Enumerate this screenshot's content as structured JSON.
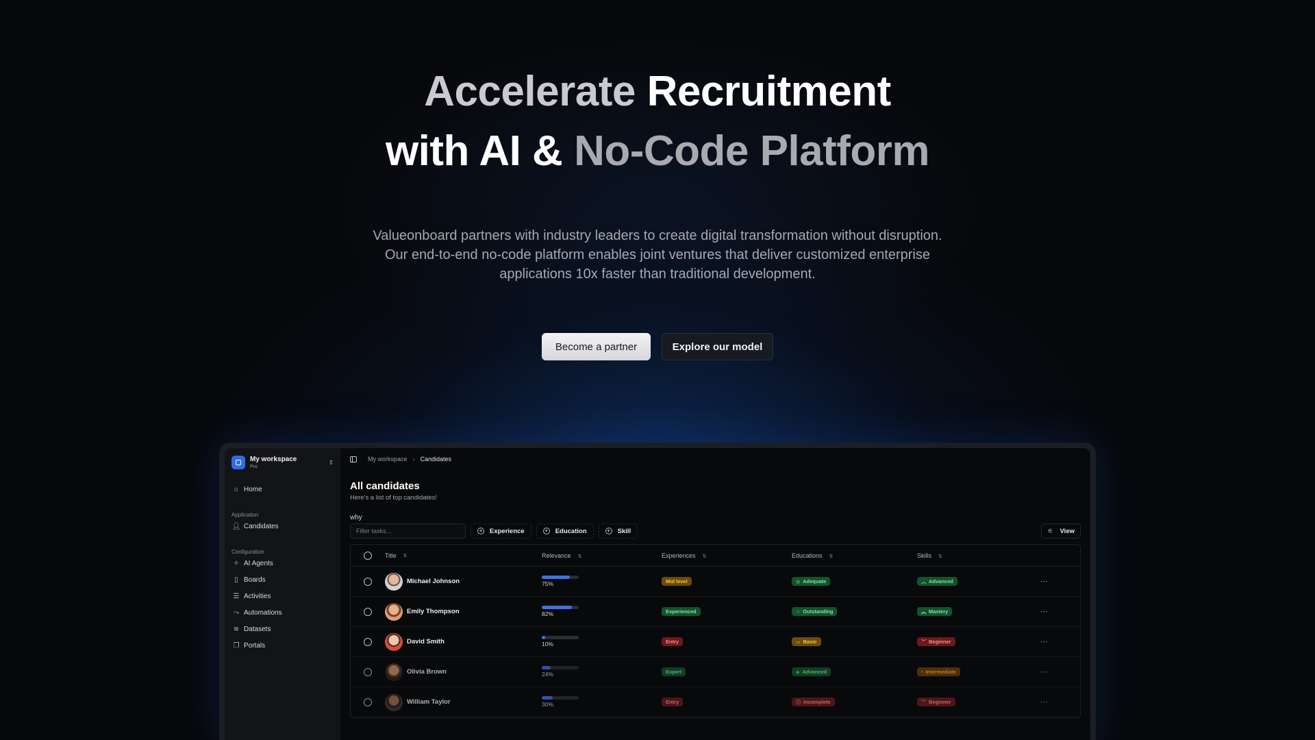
{
  "hero": {
    "line1_a": "Accelerate ",
    "line1_b": "Recruitment",
    "line2_a": "with AI & ",
    "line2_b": "No-Code Platform",
    "subtext": "Valueonboard partners with industry leaders to create digital transformation without disruption. Our end-to-end no-code platform enables joint ventures that deliver customized enterprise applications 10x faster than traditional development.",
    "primary_cta": "Become a partner",
    "secondary_cta": "Explore our model"
  },
  "workspace": {
    "name": "My workspace",
    "plan": "Pro"
  },
  "sidebar": {
    "home": "Home",
    "group_application": "Application",
    "candidates": "Candidates",
    "group_configuration": "Configuration",
    "items": [
      "AI Agents",
      "Boards",
      "Activities",
      "Automations",
      "Datasets",
      "Portals"
    ]
  },
  "breadcrumb": {
    "root": "My workspace",
    "current": "Candidates"
  },
  "page": {
    "title": "All candidates",
    "subtitle": "Here's a list of top candidates!",
    "note": "why",
    "filter_placeholder": "Filter tasks...",
    "filters": [
      "Experience",
      "Education",
      "Skill"
    ],
    "view_label": "View"
  },
  "table": {
    "columns": [
      "Title",
      "Relevance",
      "Experiences",
      "Educations",
      "Skills"
    ],
    "rows": [
      {
        "name": "Michael Johnson",
        "relevance": 75,
        "relevance_label": "75%",
        "experience": "Mid level",
        "exp_color": "yellow",
        "education": "Adequate",
        "edu_color": "green",
        "skill": "Advanced",
        "skill_color": "green"
      },
      {
        "name": "Emily Thompson",
        "relevance": 82,
        "relevance_label": "82%",
        "experience": "Experienced",
        "exp_color": "green",
        "education": "Outstanding",
        "edu_color": "green",
        "skill": "Mastery",
        "skill_color": "green"
      },
      {
        "name": "David Smith",
        "relevance": 10,
        "relevance_label": "10%",
        "experience": "Entry",
        "exp_color": "red",
        "education": "Basic",
        "edu_color": "yellow",
        "skill": "Beginner",
        "skill_color": "red"
      },
      {
        "name": "Olivia Brown",
        "relevance": 24,
        "relevance_label": "24%",
        "experience": "Expert",
        "exp_color": "green",
        "education": "Advanced",
        "edu_color": "green",
        "skill": "Intermediate",
        "skill_color": "orange"
      },
      {
        "name": "William Taylor",
        "relevance": 30,
        "relevance_label": "30%",
        "experience": "Entry",
        "exp_color": "red",
        "education": "Incomplete",
        "edu_color": "red",
        "skill": "Beginner",
        "skill_color": "red"
      }
    ]
  }
}
